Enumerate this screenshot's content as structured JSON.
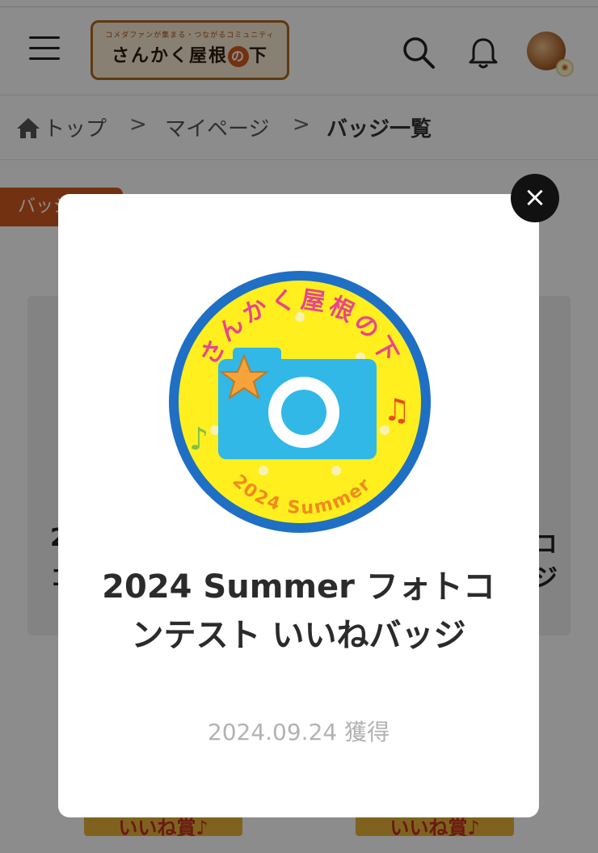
{
  "header": {
    "logo_tagline": "コメダファンが集まる・つながるコミュニティ",
    "logo_main": "さんかく屋根",
    "logo_circle": "の",
    "logo_end": "下",
    "icons": {
      "menu": "hamburger-menu-icon",
      "search": "search-icon",
      "bell": "bell-icon",
      "avatar": "user-avatar"
    }
  },
  "breadcrumb": {
    "home": "トップ",
    "separator": ">",
    "mypage": "マイページ",
    "current": "バッジ一覧"
  },
  "page": {
    "tab_label": "バッジ一覧",
    "card_left_text": "2",
    "card_left_text2": "コ",
    "card_right_text": "コ",
    "card_right_text2": "ジ",
    "ribbon_left": "いいね賞♪",
    "ribbon_right": "いいね賞♪"
  },
  "modal": {
    "close_label": "×",
    "badge": {
      "arc_text": "さんかく屋根の下",
      "year_text": "2024 Summer",
      "colors": {
        "ring": "#1f6fc4",
        "fill": "#ffef1f",
        "camera": "#31b8e6",
        "arc_text": "#e8468c",
        "year_text": "#f08a1e"
      }
    },
    "title": "2024 Summer フォトコンテスト いいねバッジ",
    "date": "2024.09.24 獲得"
  },
  "colors": {
    "accent": "#d05a1f",
    "overlay": "rgba(0,0,0,0.45)"
  }
}
